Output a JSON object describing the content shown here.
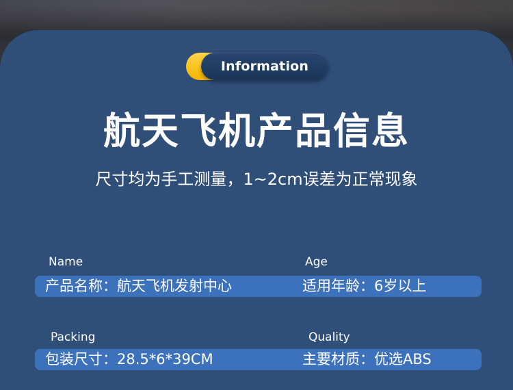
{
  "header": {
    "badge_label": "Information",
    "title": "航天飞机产品信息",
    "subtitle": "尺寸均为手工测量，1~2cm误差为正常现象"
  },
  "specs": {
    "rows": [
      {
        "left": {
          "label": "Name",
          "value": "产品名称：航天飞机发射中心"
        },
        "right": {
          "label": "Age",
          "value": "适用年龄：6岁以上"
        }
      },
      {
        "left": {
          "label": "Packing",
          "value": "包装尺寸：28.5*6*39CM"
        },
        "right": {
          "label": "Quality",
          "value": "主要材质：优选ABS"
        }
      }
    ]
  },
  "colors": {
    "panel": "#2f4e78",
    "bar": "#3c72bb",
    "badge_accent": "#f5b300",
    "badge_body": "#1f3b62",
    "text": "#ffffff"
  }
}
